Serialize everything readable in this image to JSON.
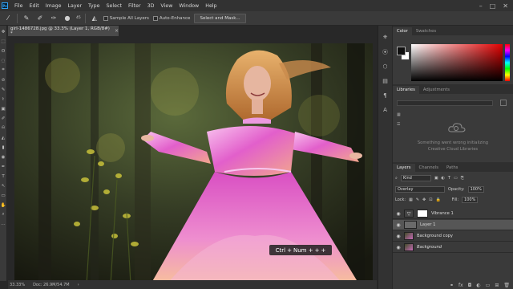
{
  "menubar": {
    "logo_text": "Ps",
    "items": [
      "File",
      "Edit",
      "Image",
      "Layer",
      "Type",
      "Select",
      "Filter",
      "3D",
      "View",
      "Window",
      "Help"
    ],
    "window_controls": [
      "–",
      "□",
      "✕"
    ]
  },
  "options_bar": {
    "brush_size": "45",
    "sample_all_layers": "Sample All Layers",
    "auto_enhance": "Auto-Enhance",
    "select_and_mask": "Select and Mask..."
  },
  "document": {
    "tab_title": "girl-1486728.jpg @ 33.3% (Layer 1, RGB/8#) *",
    "tab_close": "×",
    "zoom": "33.33%",
    "doc_size": "Doc: 26.9M/54.7M"
  },
  "shortcut_overlay": {
    "keys": [
      "Ctrl",
      "+",
      "Num +",
      "+",
      "+"
    ]
  },
  "color_panel": {
    "tabs": [
      "Color",
      "Swatches"
    ],
    "fg_color": "#101010",
    "bg_color": "#ffffff"
  },
  "libraries_panel": {
    "tabs": [
      "Libraries",
      "Adjustments"
    ],
    "message_lines": [
      "Something went wrong initializing",
      "Creative Cloud Libraries"
    ]
  },
  "layers_panel": {
    "tabs": [
      "Layers",
      "Channels",
      "Paths"
    ],
    "kind_label": "Kind",
    "blend_mode": "Overlay",
    "opacity_label": "Opacity:",
    "opacity_value": "100%",
    "lock_label": "Lock:",
    "fill_label": "Fill:",
    "fill_value": "100%",
    "layers": [
      {
        "name": "Vibrance 1",
        "visible": true,
        "selected": false
      },
      {
        "name": "Layer 1",
        "visible": true,
        "selected": true
      },
      {
        "name": "Background copy",
        "visible": true,
        "selected": false
      },
      {
        "name": "Background",
        "visible": true,
        "selected": false
      }
    ],
    "bottom_icons": [
      "link-icon",
      "fx-icon",
      "mask-icon",
      "adjustment-icon",
      "folder-icon",
      "new-layer-icon",
      "trash-icon"
    ],
    "bottom_glyphs": [
      "⚭",
      "fx",
      "◘",
      "◐",
      "▭",
      "⊞",
      "🗑"
    ]
  },
  "toolbox": {
    "glyphs": [
      "✥",
      "⬚",
      "ʘ",
      "◌",
      "⌗",
      "⊘",
      "✎",
      "⚕",
      "▣",
      "✐",
      "⎌",
      "◭",
      "▮",
      "◉",
      "✒",
      "T",
      "↖",
      "▭",
      "✋",
      "⌕",
      "⋯"
    ]
  },
  "dock": {
    "glyphs": [
      "⎈",
      "⦿",
      "⬡",
      "▤",
      "¶",
      "A"
    ]
  }
}
